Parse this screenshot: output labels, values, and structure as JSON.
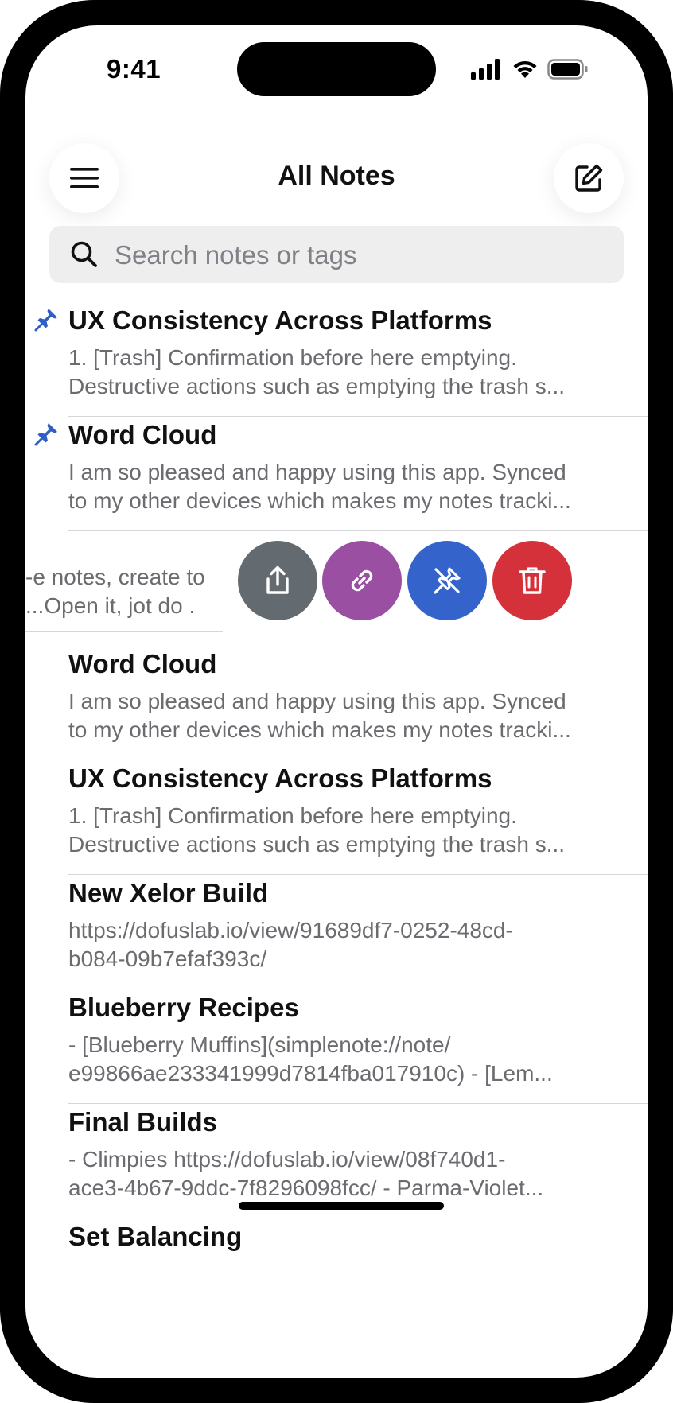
{
  "status_bar": {
    "time": "9:41"
  },
  "header": {
    "title": "All Notes"
  },
  "search": {
    "placeholder": "Search notes or tags"
  },
  "notes": [
    {
      "title": "UX Consistency Across Platforms",
      "line1": "1. [Trash] Confirmation before here emptying.",
      "line2": "Destructive actions such as emptying the trash s...",
      "pinned": true
    },
    {
      "title": "Word Cloud",
      "line1": "I am so pleased and happy using this app. Synced",
      "line2": "to my other devices which makes my notes tracki...",
      "pinned": true
    },
    {
      "title": "Word Cloud",
      "line1": "I am so pleased and happy using this app. Synced",
      "line2": "to my other devices which makes my notes tracki...",
      "pinned": false
    },
    {
      "title": "UX Consistency Across Platforms",
      "line1": "1. [Trash] Confirmation before here emptying.",
      "line2": "Destructive actions such as emptying the trash s...",
      "pinned": false
    },
    {
      "title": "New Xelor Build",
      "line1": "https://dofuslab.io/view/91689df7-0252-48cd-",
      "line2": "b084-09b7efaf393c/",
      "pinned": false
    },
    {
      "title": "Blueberry Recipes",
      "line1": "- [Blueberry Muffins](simplenote://note/",
      "line2": "e99866ae233341999d7814fba017910c) - [Lem...",
      "pinned": false
    },
    {
      "title": "Final Builds",
      "line1": "- Climpies https://dofuslab.io/view/08f740d1-",
      "line2": "ace3-4b67-9ddc-7f8296098fcc/ - Parma-Violet...",
      "pinned": false
    },
    {
      "title": "Set Balancing",
      "line1": "",
      "line2": "",
      "pinned": false
    }
  ],
  "swiped_note": {
    "line1": "e notes, create to-",
    "line2": ". Open it, jot do..."
  },
  "swipe_actions": [
    {
      "name": "share",
      "icon": "share-icon",
      "color": "#636a70"
    },
    {
      "name": "copy-link",
      "icon": "link-icon",
      "color": "#9a4fa3"
    },
    {
      "name": "unpin",
      "icon": "unpin-icon",
      "color": "#3463cc"
    },
    {
      "name": "trash",
      "icon": "trash-icon",
      "color": "#d4313a"
    }
  ],
  "colors": {
    "pin": "#2f5fc4",
    "accent": "#3463cc"
  }
}
